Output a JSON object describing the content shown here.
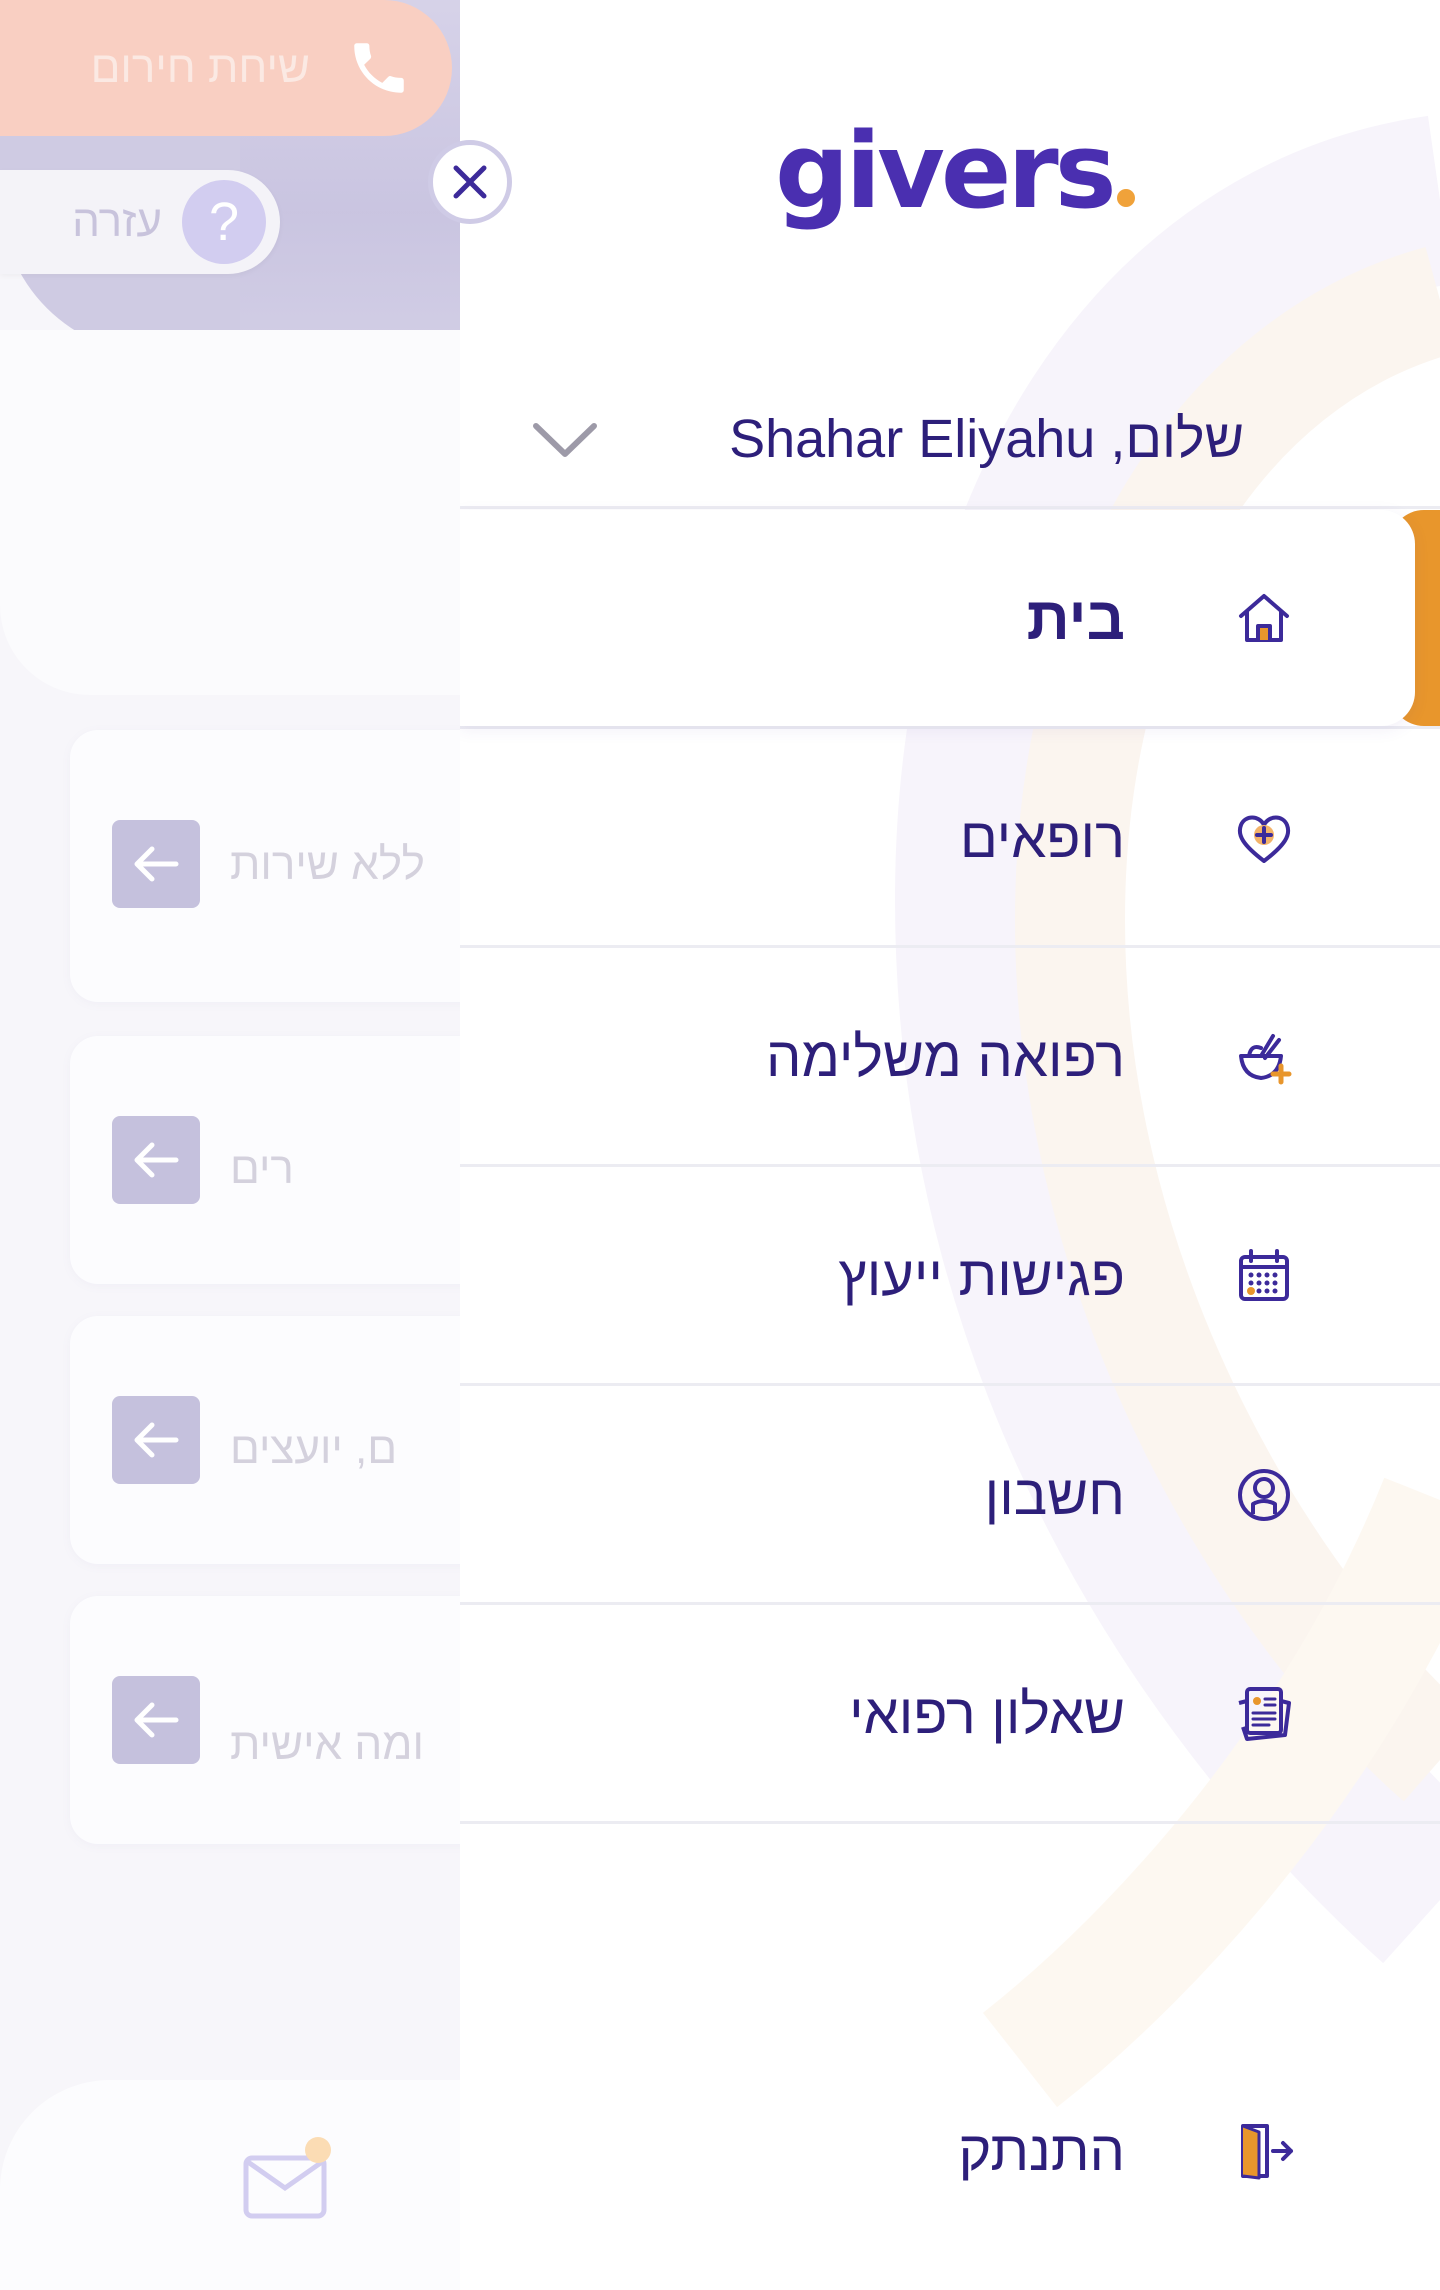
{
  "background": {
    "emergency_call_label": "שיחת חירום",
    "help_label": "עזרה",
    "help_icon_glyph": "?",
    "cards": [
      {
        "text": "ללא שירות"
      },
      {
        "text": "רים"
      },
      {
        "text": "ם, יועצים"
      },
      {
        "text": "ומה אישית"
      }
    ]
  },
  "drawer": {
    "logo_text": "givers",
    "greeting": "שלום, Shahar Eliyahu",
    "menu": [
      {
        "label": "בית",
        "icon": "home-icon",
        "active": true
      },
      {
        "label": "רופאים",
        "icon": "heart-plus-icon",
        "active": false
      },
      {
        "label": "רפואה משלימה",
        "icon": "herbal-medicine-icon",
        "active": false
      },
      {
        "label": "פגישות ייעוץ",
        "icon": "calendar-icon",
        "active": false
      },
      {
        "label": "חשבון",
        "icon": "account-icon",
        "active": false
      },
      {
        "label": "שאלון רפואי",
        "icon": "questionnaire-icon",
        "active": false
      }
    ],
    "logout_label": "התנתק",
    "logout_icon": "logout-door-icon"
  },
  "colors": {
    "brand_purple": "#4a2fb0",
    "text_navy": "#2d1f7a",
    "accent_orange": "#e8962c",
    "emergency_peach": "#f9cfc2",
    "muted_lavender": "#c5c1dd"
  }
}
